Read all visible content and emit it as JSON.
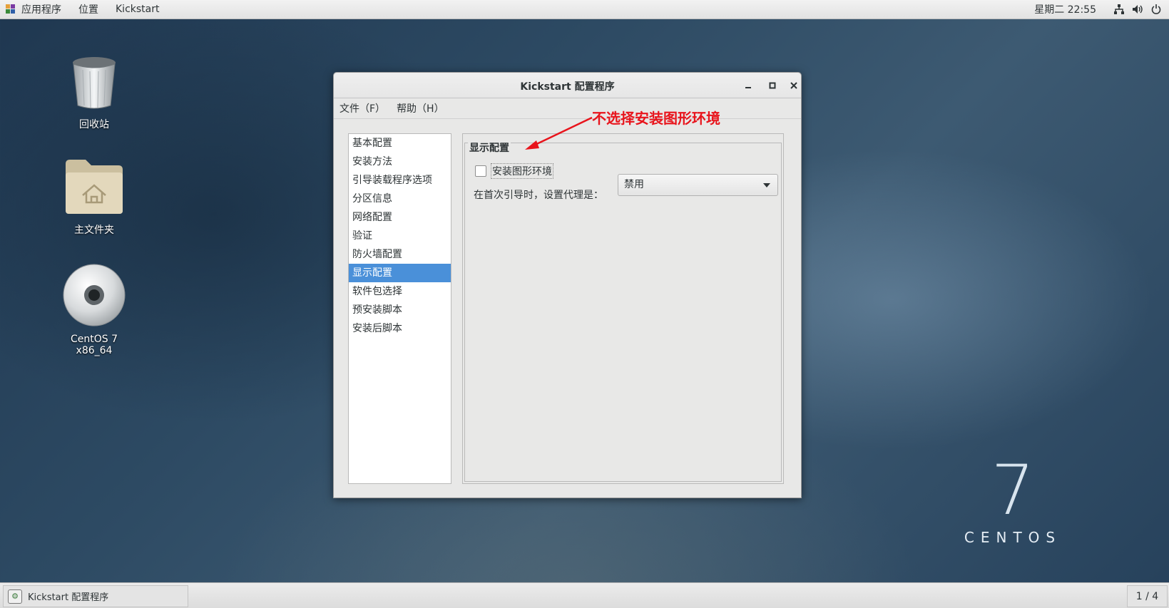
{
  "topbar": {
    "menus": [
      "应用程序",
      "位置",
      "Kickstart"
    ],
    "clock": "星期二 22:55",
    "tray_icons": [
      "network-icon",
      "volume-icon",
      "power-icon"
    ]
  },
  "desktop": {
    "icons": [
      {
        "label": "回收站",
        "icon": "trash-icon"
      },
      {
        "label": "主文件夹",
        "icon": "home-folder-icon"
      },
      {
        "label": "CentOS 7 x86_64",
        "icon": "disc-icon"
      }
    ],
    "brand": {
      "number": "7",
      "word": "CENTOS"
    }
  },
  "window": {
    "title": "Kickstart 配置程序",
    "menu": [
      "文件（F）",
      "帮助（H）"
    ],
    "sidebar": [
      "基本配置",
      "安装方法",
      "引导装载程序选项",
      "分区信息",
      "网络配置",
      "验证",
      "防火墙配置",
      "显示配置",
      "软件包选择",
      "预安装脚本",
      "安装后脚本"
    ],
    "sidebar_selected": 7,
    "panel": {
      "section_title": "显示配置",
      "checkbox_label": "安装图形环境",
      "checkbox_checked": false,
      "proxy_label": "在首次引导时，设置代理是：",
      "proxy_value": "禁用"
    }
  },
  "annotation": {
    "text": "不选择安装图形环境",
    "color": "#e8141c"
  },
  "taskbar": {
    "task_label": "Kickstart 配置程序",
    "pager": "1 / 4"
  },
  "colors": {
    "selection": "#4a90d9",
    "annotation": "#e8141c"
  }
}
